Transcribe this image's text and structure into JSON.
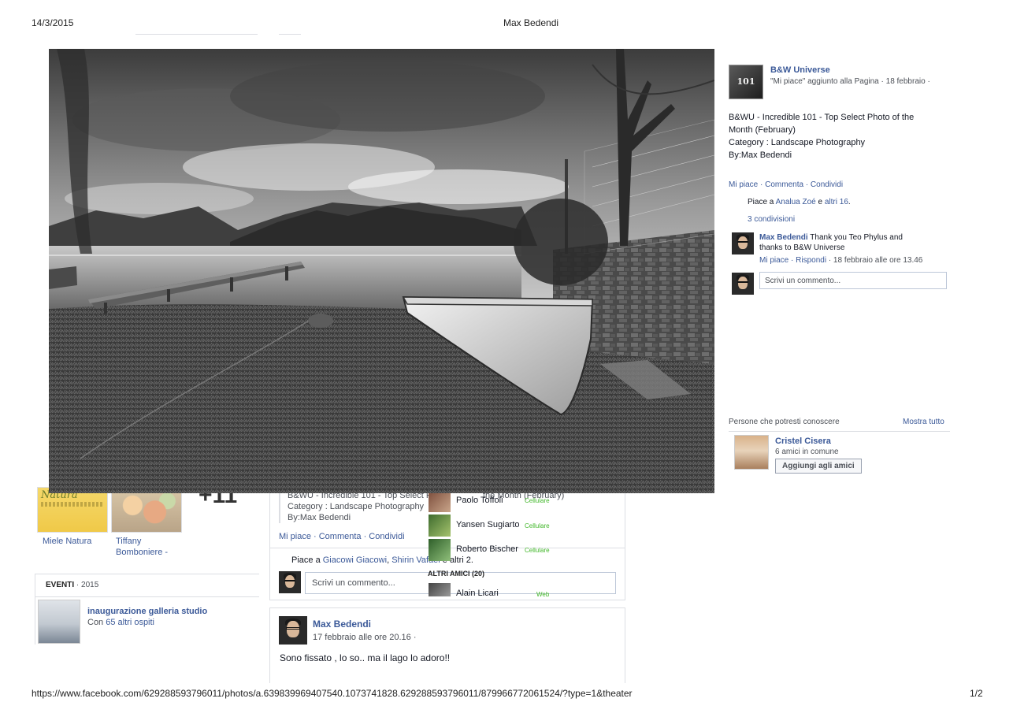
{
  "print": {
    "date": "14/3/2015",
    "title": "Max Bedendi",
    "url": "https://www.facebook.com/629288593796011/photos/a.639839969407540.1073741828.629288593796011/879966772061524/?type=1&theater",
    "page": "1/2"
  },
  "background": {
    "photos": [
      {
        "caption": "Miele Natura",
        "brand": "Natura"
      },
      {
        "caption": "Tiffany Bomboniere -"
      }
    ],
    "more_count": "+11",
    "events": {
      "label": "EVENTI",
      "year": "· 2015",
      "title": "inaugurazione galleria studio",
      "sub_prefix": "Con ",
      "guests_link": "65 altri ospiti"
    },
    "shared_post": {
      "line1": "B&WU - Incredible 101 - Top Select P",
      "line1_tail": "the Month (February)",
      "line2": "Category : Landscape Photography",
      "line3": "By:Max Bedendi",
      "actions": "Mi piace · Commenta · Condividi",
      "likes_prefix": "Piace a ",
      "likes_link1": "Giacowi Giacowi",
      "likes_sep": ", ",
      "likes_link2": "Shirin Vafaei",
      "likes_tail": " e altri 2.",
      "comment_placeholder": "Scrivi un commento..."
    },
    "chat": {
      "rows": [
        {
          "name": "Paolo Toffoli",
          "status": "Cellulare"
        },
        {
          "name": "Yansen Sugiarto",
          "status": "Cellulare"
        },
        {
          "name": "Roberto Bischer",
          "status": "Cellulare"
        }
      ],
      "section": "ALTRI AMICI (20)",
      "extra": {
        "name": "Alain Licari",
        "status": "Web"
      }
    },
    "post": {
      "name": "Max Bedendi",
      "time": "17 febbraio alle ore 20.16 ·",
      "body": "Sono fissato , lo so.. ma il lago lo adoro!!"
    }
  },
  "right_panel": {
    "page_name": "B&W Universe",
    "page_badge": "101",
    "page_sub": "\"Mi piace\" aggiunto alla Pagina · 18 febbraio ·",
    "description": [
      "B&WU - Incredible 101 - Top Select Photo of the",
      "Month (February)",
      "Category : Landscape Photography",
      "By:Max Bedendi"
    ],
    "actions": "Mi piace · Commenta · Condividi",
    "likes_prefix": "Piace a ",
    "likes_link1": "Analua Zoé",
    "likes_mid": " e ",
    "likes_link2": "altri 16",
    "likes_tail": ".",
    "shares": "3 condivisioni",
    "comment": {
      "name": "Max Bedendi",
      "text1": " Thank you Teo Phylus and",
      "text2": "thanks to B&W Universe",
      "meta_like": "Mi piace · Rispondi",
      "meta_time": " · 18 febbraio alle ore 13.46"
    },
    "comment_placeholder": "Scrivi un commento...",
    "pymk": {
      "title": "Persone che potresti conoscere",
      "see_all": "Mostra tutto",
      "name": "Cristel Cisera",
      "mutual": "6 amici in comune",
      "button": "Aggiungi agli amici"
    }
  }
}
